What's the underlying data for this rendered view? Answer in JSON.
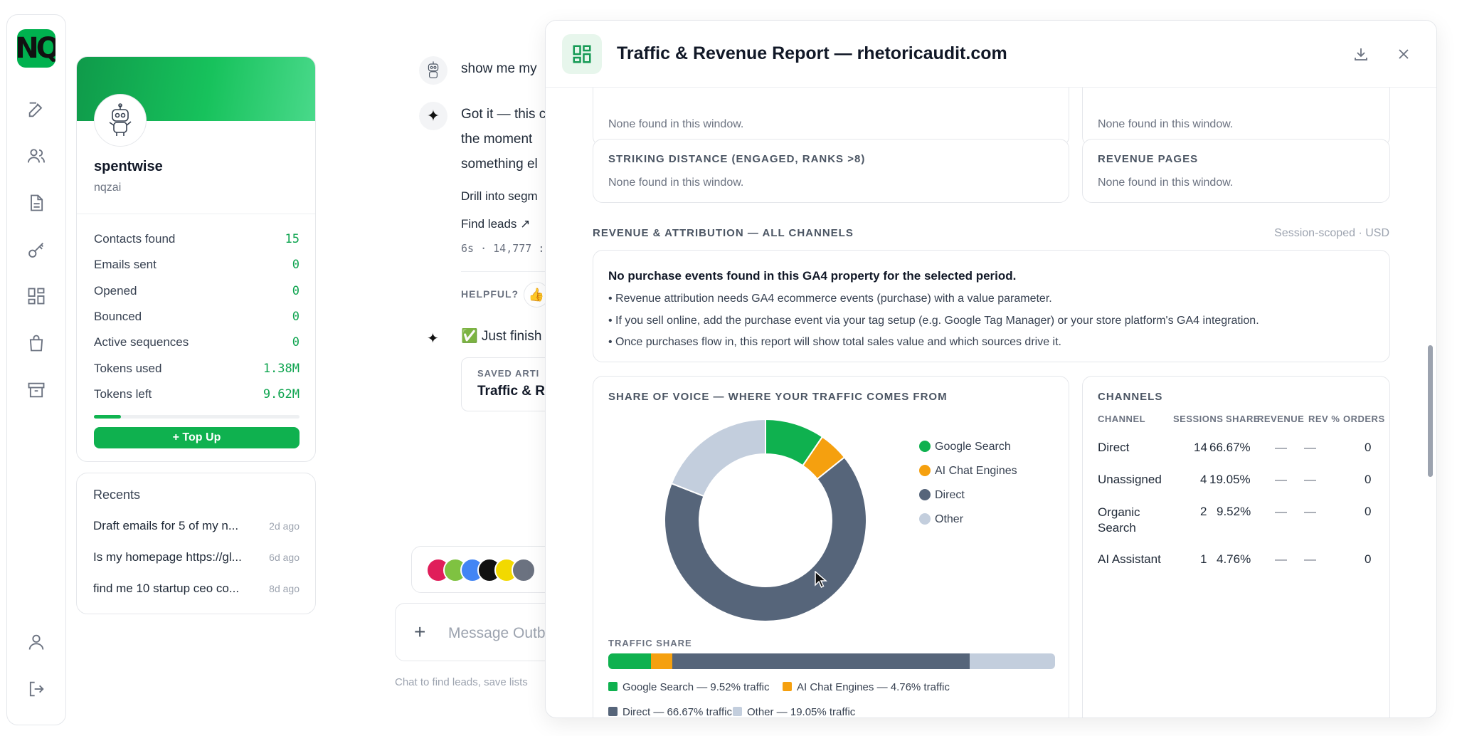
{
  "profile": {
    "name": "spentwise",
    "handle": "nqzai",
    "stats": [
      {
        "label": "Contacts found",
        "value": "15"
      },
      {
        "label": "Emails sent",
        "value": "0"
      },
      {
        "label": "Opened",
        "value": "0"
      },
      {
        "label": "Bounced",
        "value": "0"
      },
      {
        "label": "Active sequences",
        "value": "0"
      },
      {
        "label": "Tokens used",
        "value": "1.38M"
      },
      {
        "label": "Tokens left",
        "value": "9.62M"
      }
    ],
    "token_usage_fraction": 0.13,
    "topup_label": "+ Top Up"
  },
  "brand": {
    "logo_text": "NQ",
    "accent": "#0fb14f"
  },
  "recents": {
    "title": "Recents",
    "items": [
      {
        "text": "Draft emails for 5 of my n...",
        "date": "2d ago"
      },
      {
        "text": "Is my homepage https://gl...",
        "date": "6d ago"
      },
      {
        "text": "find me 10 startup ceo co...",
        "date": "8d ago"
      }
    ]
  },
  "chat": {
    "user_message": "show me my",
    "assistant_lines": [
      "Got it — this c",
      "the moment",
      "something el"
    ],
    "drill_text": "Drill into segm",
    "find_leads": "Find leads ↗",
    "meta": "6s · 14,777 :",
    "helpful_label": "HELPFUL?",
    "update_text": "✅ Just finish",
    "saved_label": "SAVED ARTI",
    "saved_title": "Traffic & Re",
    "composer_placeholder": "Message Outb",
    "footnote": "Chat to find leads, save lists"
  },
  "report": {
    "title": "Traffic & Revenue Report — rhetoricaudit.com",
    "top_cards": [
      {
        "label": "",
        "text": "None found in this window."
      },
      {
        "label": "",
        "text": "None found in this window."
      }
    ],
    "striking": {
      "label": "STRIKING DISTANCE (ENGAGED, RANKS >8)",
      "text": "None found in this window."
    },
    "revenue_pages": {
      "label": "REVENUE PAGES",
      "text": "None found in this window."
    },
    "attribution": {
      "label": "REVENUE & ATTRIBUTION — ALL CHANNELS",
      "scope": "Session-scoped · USD",
      "heading": "No purchase events found in this GA4 property for the selected period.",
      "bullets": [
        "• Revenue attribution needs GA4 ecommerce events (purchase) with a value parameter.",
        "• If you sell online, add the purchase event via your tag setup (e.g. Google Tag Manager) or your store platform's GA4 integration.",
        "• Once purchases flow in, this report will show total sales value and which sources drive it."
      ]
    },
    "share_of_voice": {
      "label": "SHARE OF VOICE — WHERE YOUR TRAFFIC COMES FROM",
      "traffic_share_label": "TRAFFIC SHARE",
      "legend": [
        "Google Search",
        "AI Chat Engines",
        "Direct",
        "Other"
      ],
      "bar_legend": [
        "Google Search — 9.52% traffic",
        "AI Chat Engines — 4.76% traffic",
        "Direct — 66.67% traffic",
        "Other — 19.05% traffic"
      ]
    },
    "channels": {
      "label": "CHANNELS",
      "headers": [
        "CHANNEL",
        "SESSIONS",
        "SHARE",
        "REVENUE",
        "REV %",
        "ORDERS"
      ],
      "rows": [
        {
          "channel": "Direct",
          "sessions": "14",
          "share": "66.67%",
          "revenue": "—",
          "rev_pct": "—",
          "orders": "0"
        },
        {
          "channel": "Unassigned",
          "sessions": "4",
          "share": "19.05%",
          "revenue": "—",
          "rev_pct": "—",
          "orders": "0"
        },
        {
          "channel": "Organic Search",
          "sessions": "2",
          "share": "9.52%",
          "revenue": "—",
          "rev_pct": "—",
          "orders": "0"
        },
        {
          "channel": "AI Assistant",
          "sessions": "1",
          "share": "4.76%",
          "revenue": "—",
          "rev_pct": "—",
          "orders": "0"
        }
      ]
    }
  },
  "chart_data": {
    "type": "pie",
    "categories": [
      "Google Search",
      "AI Chat Engines",
      "Direct",
      "Other"
    ],
    "values": [
      9.52,
      4.76,
      66.67,
      19.05
    ],
    "colors": [
      "#0fb14f",
      "#f5a00f",
      "#56657a",
      "#c3cedd"
    ],
    "title": "",
    "legend_position": "right"
  },
  "colors": {
    "green": "#0fb14f",
    "orange": "#f5a00f",
    "slate": "#56657a",
    "light": "#c3cedd"
  }
}
